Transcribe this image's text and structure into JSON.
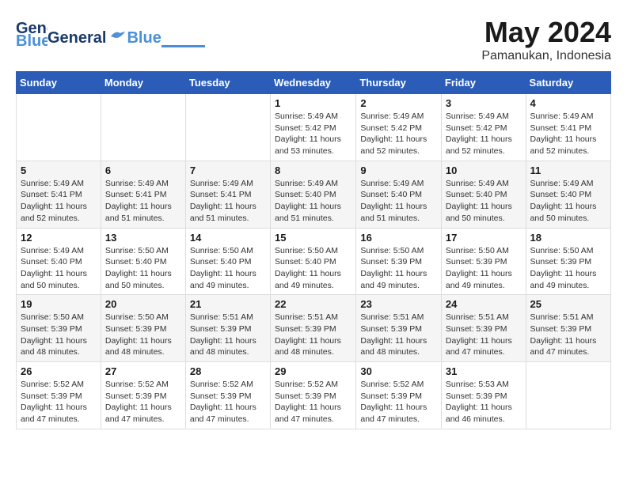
{
  "header": {
    "logo_main": "General",
    "logo_accent": "Blue",
    "month_title": "May 2024",
    "location": "Pamanukan, Indonesia"
  },
  "days_of_week": [
    "Sunday",
    "Monday",
    "Tuesday",
    "Wednesday",
    "Thursday",
    "Friday",
    "Saturday"
  ],
  "weeks": [
    [
      {
        "day": "",
        "info": ""
      },
      {
        "day": "",
        "info": ""
      },
      {
        "day": "",
        "info": ""
      },
      {
        "day": "1",
        "info": "Sunrise: 5:49 AM\nSunset: 5:42 PM\nDaylight: 11 hours and 53 minutes."
      },
      {
        "day": "2",
        "info": "Sunrise: 5:49 AM\nSunset: 5:42 PM\nDaylight: 11 hours and 52 minutes."
      },
      {
        "day": "3",
        "info": "Sunrise: 5:49 AM\nSunset: 5:42 PM\nDaylight: 11 hours and 52 minutes."
      },
      {
        "day": "4",
        "info": "Sunrise: 5:49 AM\nSunset: 5:41 PM\nDaylight: 11 hours and 52 minutes."
      }
    ],
    [
      {
        "day": "5",
        "info": "Sunrise: 5:49 AM\nSunset: 5:41 PM\nDaylight: 11 hours and 52 minutes."
      },
      {
        "day": "6",
        "info": "Sunrise: 5:49 AM\nSunset: 5:41 PM\nDaylight: 11 hours and 51 minutes."
      },
      {
        "day": "7",
        "info": "Sunrise: 5:49 AM\nSunset: 5:41 PM\nDaylight: 11 hours and 51 minutes."
      },
      {
        "day": "8",
        "info": "Sunrise: 5:49 AM\nSunset: 5:40 PM\nDaylight: 11 hours and 51 minutes."
      },
      {
        "day": "9",
        "info": "Sunrise: 5:49 AM\nSunset: 5:40 PM\nDaylight: 11 hours and 51 minutes."
      },
      {
        "day": "10",
        "info": "Sunrise: 5:49 AM\nSunset: 5:40 PM\nDaylight: 11 hours and 50 minutes."
      },
      {
        "day": "11",
        "info": "Sunrise: 5:49 AM\nSunset: 5:40 PM\nDaylight: 11 hours and 50 minutes."
      }
    ],
    [
      {
        "day": "12",
        "info": "Sunrise: 5:49 AM\nSunset: 5:40 PM\nDaylight: 11 hours and 50 minutes."
      },
      {
        "day": "13",
        "info": "Sunrise: 5:50 AM\nSunset: 5:40 PM\nDaylight: 11 hours and 50 minutes."
      },
      {
        "day": "14",
        "info": "Sunrise: 5:50 AM\nSunset: 5:40 PM\nDaylight: 11 hours and 49 minutes."
      },
      {
        "day": "15",
        "info": "Sunrise: 5:50 AM\nSunset: 5:40 PM\nDaylight: 11 hours and 49 minutes."
      },
      {
        "day": "16",
        "info": "Sunrise: 5:50 AM\nSunset: 5:39 PM\nDaylight: 11 hours and 49 minutes."
      },
      {
        "day": "17",
        "info": "Sunrise: 5:50 AM\nSunset: 5:39 PM\nDaylight: 11 hours and 49 minutes."
      },
      {
        "day": "18",
        "info": "Sunrise: 5:50 AM\nSunset: 5:39 PM\nDaylight: 11 hours and 49 minutes."
      }
    ],
    [
      {
        "day": "19",
        "info": "Sunrise: 5:50 AM\nSunset: 5:39 PM\nDaylight: 11 hours and 48 minutes."
      },
      {
        "day": "20",
        "info": "Sunrise: 5:50 AM\nSunset: 5:39 PM\nDaylight: 11 hours and 48 minutes."
      },
      {
        "day": "21",
        "info": "Sunrise: 5:51 AM\nSunset: 5:39 PM\nDaylight: 11 hours and 48 minutes."
      },
      {
        "day": "22",
        "info": "Sunrise: 5:51 AM\nSunset: 5:39 PM\nDaylight: 11 hours and 48 minutes."
      },
      {
        "day": "23",
        "info": "Sunrise: 5:51 AM\nSunset: 5:39 PM\nDaylight: 11 hours and 48 minutes."
      },
      {
        "day": "24",
        "info": "Sunrise: 5:51 AM\nSunset: 5:39 PM\nDaylight: 11 hours and 47 minutes."
      },
      {
        "day": "25",
        "info": "Sunrise: 5:51 AM\nSunset: 5:39 PM\nDaylight: 11 hours and 47 minutes."
      }
    ],
    [
      {
        "day": "26",
        "info": "Sunrise: 5:52 AM\nSunset: 5:39 PM\nDaylight: 11 hours and 47 minutes."
      },
      {
        "day": "27",
        "info": "Sunrise: 5:52 AM\nSunset: 5:39 PM\nDaylight: 11 hours and 47 minutes."
      },
      {
        "day": "28",
        "info": "Sunrise: 5:52 AM\nSunset: 5:39 PM\nDaylight: 11 hours and 47 minutes."
      },
      {
        "day": "29",
        "info": "Sunrise: 5:52 AM\nSunset: 5:39 PM\nDaylight: 11 hours and 47 minutes."
      },
      {
        "day": "30",
        "info": "Sunrise: 5:52 AM\nSunset: 5:39 PM\nDaylight: 11 hours and 47 minutes."
      },
      {
        "day": "31",
        "info": "Sunrise: 5:53 AM\nSunset: 5:39 PM\nDaylight: 11 hours and 46 minutes."
      },
      {
        "day": "",
        "info": ""
      }
    ]
  ]
}
